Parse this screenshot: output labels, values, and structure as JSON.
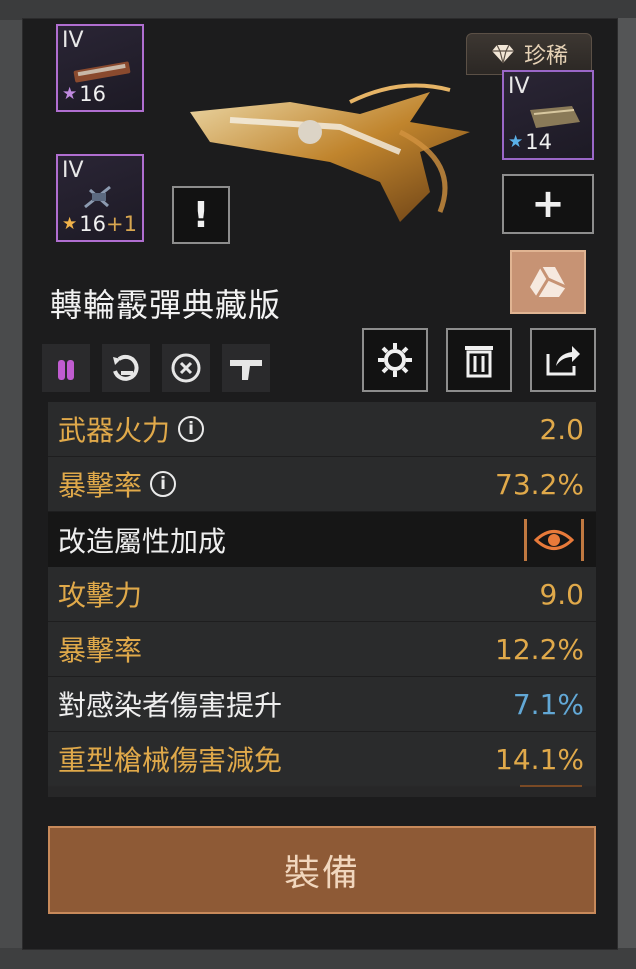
{
  "modules": [
    {
      "tier": "IV",
      "rank": "16",
      "star_color": "#c08ae0"
    },
    {
      "tier": "IV",
      "rank": "16",
      "rank_bonus": "+1",
      "star_color": "#f0b24a"
    },
    {
      "tier": "IV",
      "rank": "14",
      "star_color": "#5ab0e8"
    }
  ],
  "rarity": {
    "label": "珍稀",
    "icon": "diamond-icon"
  },
  "weapon": {
    "name": "轉輪霰彈典藏版"
  },
  "buttons": {
    "alert": "!",
    "add": "+",
    "gear": "gear-icon",
    "delete": "trash-icon",
    "share": "share-icon",
    "equip": "裝備"
  },
  "stats": [
    {
      "label": "武器火力",
      "value": "2.0",
      "info": true
    },
    {
      "label": "暴擊率",
      "value": "73.2%",
      "info": true
    }
  ],
  "mod_section": {
    "title": "改造屬性加成"
  },
  "mod_stats": [
    {
      "label": "攻擊力",
      "value": "9.0"
    },
    {
      "label": "暴擊率",
      "value": "12.2%"
    },
    {
      "label": "對感染者傷害提升",
      "value": "7.1%"
    },
    {
      "label": "重型槍械傷害減免",
      "value": "14.1%"
    }
  ],
  "colors": {
    "accent": "#e0a94a",
    "blue_value": "#62a8d6",
    "equip_bg": "#8e5a36"
  }
}
